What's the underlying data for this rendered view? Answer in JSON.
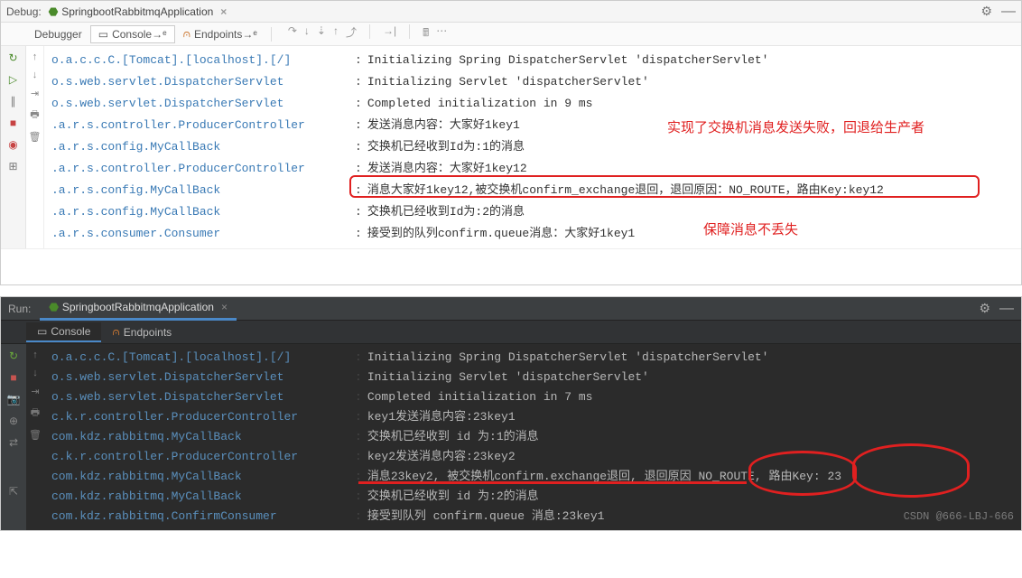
{
  "light": {
    "debug_label": "Debug:",
    "app_name": "SpringbootRabbitmqApplication",
    "tabs": {
      "debugger": "Debugger",
      "console": "Console",
      "endpoints": "Endpoints"
    },
    "lines": [
      {
        "logger": "o.a.c.c.C.[Tomcat].[localhost].[/]",
        "msg": "Initializing Spring DispatcherServlet 'dispatcherServlet'"
      },
      {
        "logger": "o.s.web.servlet.DispatcherServlet",
        "msg": "Initializing Servlet 'dispatcherServlet'"
      },
      {
        "logger": "o.s.web.servlet.DispatcherServlet",
        "msg": "Completed initialization in 9 ms"
      },
      {
        "logger": ".a.r.s.controller.ProducerController",
        "msg": "发送消息内容：大家好1key1"
      },
      {
        "logger": ".a.r.s.config.MyCallBack",
        "msg": "交换机已经收到Id为:1的消息"
      },
      {
        "logger": ".a.r.s.controller.ProducerController",
        "msg": "发送消息内容：大家好1key12"
      },
      {
        "logger": ".a.r.s.config.MyCallBack",
        "msg": "消息大家好1key12,被交换机confirm_exchange退回，退回原因：NO_ROUTE，路由Key:key12"
      },
      {
        "logger": ".a.r.s.config.MyCallBack",
        "msg": "交换机已经收到Id为:2的消息"
      },
      {
        "logger": ".a.r.s.consumer.Consumer",
        "msg": "接受到的队列confirm.queue消息：大家好1key1"
      }
    ],
    "anno1": "实现了交换机消息发送失败，回退给生产者",
    "anno2": "保障消息不丢失"
  },
  "dark": {
    "run_label": "Run:",
    "app_name": "SpringbootRabbitmqApplication",
    "tabs": {
      "console": "Console",
      "endpoints": "Endpoints"
    },
    "lines": [
      {
        "logger": "o.a.c.c.C.[Tomcat].[localhost].[/]",
        "msg": "Initializing Spring DispatcherServlet 'dispatcherServlet'"
      },
      {
        "logger": "o.s.web.servlet.DispatcherServlet",
        "msg": "Initializing Servlet 'dispatcherServlet'"
      },
      {
        "logger": "o.s.web.servlet.DispatcherServlet",
        "msg": "Completed initialization in 7 ms"
      },
      {
        "logger": "c.k.r.controller.ProducerController",
        "msg": "key1发送消息内容:23key1"
      },
      {
        "logger": "com.kdz.rabbitmq.MyCallBack",
        "msg": "交换机已经收到 id 为:1的消息"
      },
      {
        "logger": "c.k.r.controller.ProducerController",
        "msg": "key2发送消息内容:23key2"
      },
      {
        "logger": "com.kdz.rabbitmq.MyCallBack",
        "msg": "消息23key2, 被交换机confirm.exchange退回, 退回原因  NO_ROUTE, 路由Key: 23"
      },
      {
        "logger": "com.kdz.rabbitmq.MyCallBack",
        "msg": "交换机已经收到 id 为:2的消息"
      },
      {
        "logger": "com.kdz.rabbitmq.ConfirmConsumer",
        "msg": "接受到队列 confirm.queue 消息:23key1"
      }
    ],
    "watermark": "CSDN @666-LBJ-666"
  }
}
